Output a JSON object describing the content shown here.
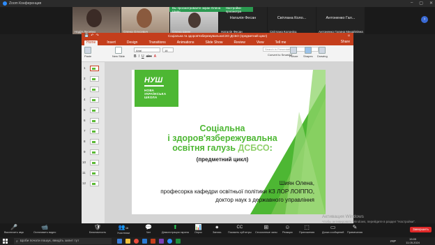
{
  "zoom": {
    "window_title": "Zoom Конференция",
    "banner": [
      "Вы просматриваете экран Олена Шиян",
      "Настройки просмотра"
    ],
    "participants": [
      {
        "name": "Надія Лесевко"
      },
      {
        "name": "Олена Олусевич"
      },
      {
        "name": "Олена Шиян"
      },
      {
        "name": "Наталія Фесан"
      },
      {
        "name": "Світлана Колонієц"
      },
      {
        "name": "Антоненко Галина Михайлівна"
      }
    ],
    "tile_big_names": [
      "Наталія Фесан",
      "Світлана Коло...",
      "Антоненко Гал..."
    ],
    "toolbar": [
      {
        "label": "Выключить звук",
        "icon": "🎤"
      },
      {
        "label": "Остановить видео",
        "icon": "📹"
      },
      {
        "label": "Безопасность",
        "icon": "🛡"
      },
      {
        "label": "Участники",
        "icon": "👥",
        "count": "16"
      },
      {
        "label": "Чат",
        "icon": "💬"
      },
      {
        "label": "Демонстрация экрана",
        "icon": "⬆"
      },
      {
        "label": "Опрос",
        "icon": "📊"
      },
      {
        "label": "Запись",
        "icon": "⏺"
      },
      {
        "label": "Показать субтитры",
        "icon": "CC"
      },
      {
        "label": "Сессионные залы",
        "icon": "⊞"
      },
      {
        "label": "Реакции",
        "icon": "☺"
      },
      {
        "label": "Приложения",
        "icon": "⬚"
      },
      {
        "label": "Доска сообщений",
        "icon": "▭"
      },
      {
        "label": "Примечания",
        "icon": "✎"
      }
    ],
    "end_label": "Завершить",
    "activation_title": "Активация Windows",
    "activation_sub": "Чтобы активировать Windows, перейдите в раздел \"Настройки\"."
  },
  "ppt": {
    "title": "Соціальна та здоров'язбережувальнаСЗО ДСБО (предметний цикл)",
    "tabs": [
      "Home",
      "Insert",
      "Design",
      "Transitions",
      "Animations",
      "Slide Show",
      "Review",
      "View"
    ],
    "tell_me": "Tell me",
    "share": "Share",
    "ribbon": {
      "paste": "Paste",
      "new_slide": "New Slide",
      "font_name": "Arial",
      "font_size": "18",
      "search_placeholder": "Search in Presentation",
      "convert": "Convert to SmartArt",
      "picture": "Picture",
      "shapes": "Shapes",
      "drawing": "Drawing"
    },
    "slide_numbers": [
      "1",
      "2",
      "3",
      "4",
      "5",
      "6",
      "7",
      "8",
      "9",
      "10",
      "11",
      "12"
    ],
    "slide": {
      "logo_mark": "НУШ",
      "logo_sub": [
        "НОВА",
        "УКРАЇНСЬКА",
        "ШКОЛА"
      ],
      "heading_line1": "Соціальна",
      "heading_line2": "і здоров'язбережувальна",
      "heading_line3_a": "освітня галузь ",
      "heading_line3_b": "ДСБСО",
      "heading_line3_c": ":",
      "subtitle": "(предметний цикл)",
      "author_line1": "Шиян Олена,",
      "author_line2": "професорка кафедри освітньої політики КЗ ЛОР ЛОІППО,",
      "author_line3": "доктор наук з державного управління"
    },
    "colors": {
      "accent": "#c43e1c",
      "green": "#4db733"
    }
  },
  "taskbar": {
    "search_placeholder": "Щоби почати пошук, введіть запит тут",
    "lang": "УКР",
    "time": "15:05",
    "date": "11.05.2024"
  }
}
